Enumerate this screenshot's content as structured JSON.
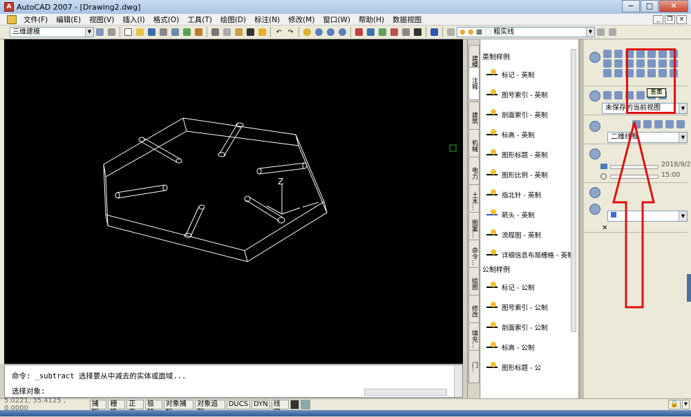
{
  "window": {
    "title": "AutoCAD 2007 - [Drawing2.dwg]"
  },
  "menubar": {
    "items": [
      "文件(F)",
      "编辑(E)",
      "视图(V)",
      "插入(I)",
      "格式(O)",
      "工具(T)",
      "绘图(D)",
      "标注(N)",
      "修改(M)",
      "窗口(W)",
      "帮助(H)",
      "数据视图"
    ]
  },
  "toolbar": {
    "workspace_value": "三维建模",
    "linetype_value": "粗实线",
    "colors": {
      "accent": "#3b6db3",
      "warning": "#e01010"
    }
  },
  "command": {
    "line1": "命令: _subtract 选择要从中减去的实体或面域...",
    "line2": "选择对象:"
  },
  "status": {
    "coords": "5.0221, 35.4125 , 0.0000",
    "toggles": [
      "捕捉",
      "栅格",
      "正交",
      "极轴",
      "对象捕捉",
      "对象追踪",
      "DUCS",
      "DYN",
      "线宽"
    ]
  },
  "palette": {
    "tabs": [
      "建模",
      "注释",
      "建筑",
      "机械",
      "电力",
      "土木...",
      "图案...",
      "命令...",
      "绘图",
      "修改",
      "填充...",
      "门.."
    ],
    "section1": "英制样例",
    "section1_items": [
      "标记 - 英制",
      "图号索引 - 英制",
      "剖面索引 - 英制",
      "标高 - 英制",
      "图形标题 - 英制",
      "图形比例 - 英制",
      "指北针 - 英制",
      "箭头 - 英制",
      "流程图 - 英制",
      "详细信息布局栅格 - 英制"
    ],
    "section2": "公制样例",
    "section2_items": [
      "标记 - 公制",
      "图号索引 - 公制",
      "剖面索引 - 公制",
      "标高 - 公制",
      "图形标题 - 公"
    ]
  },
  "dashboard": {
    "view_label": "未保存的当前视图",
    "visual_style": "二维线框",
    "date": "2018/9/2",
    "time": "15:00",
    "tooltip": "差集"
  },
  "canvas": {
    "axis_label": "Z"
  }
}
